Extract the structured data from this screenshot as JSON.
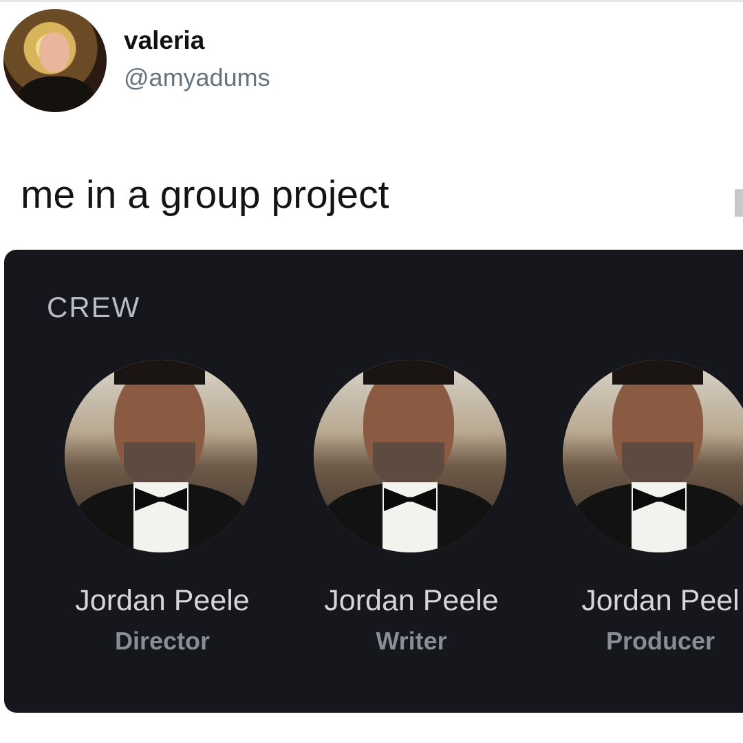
{
  "tweet": {
    "display_name": "valeria",
    "handle": "@amyadums",
    "text": "me in a group project"
  },
  "card": {
    "heading": "CREW",
    "members": [
      {
        "name": "Jordan Peele",
        "role": "Director"
      },
      {
        "name": "Jordan Peele",
        "role": "Writer"
      },
      {
        "name": "Jordan Peel",
        "role": "Producer"
      }
    ]
  }
}
